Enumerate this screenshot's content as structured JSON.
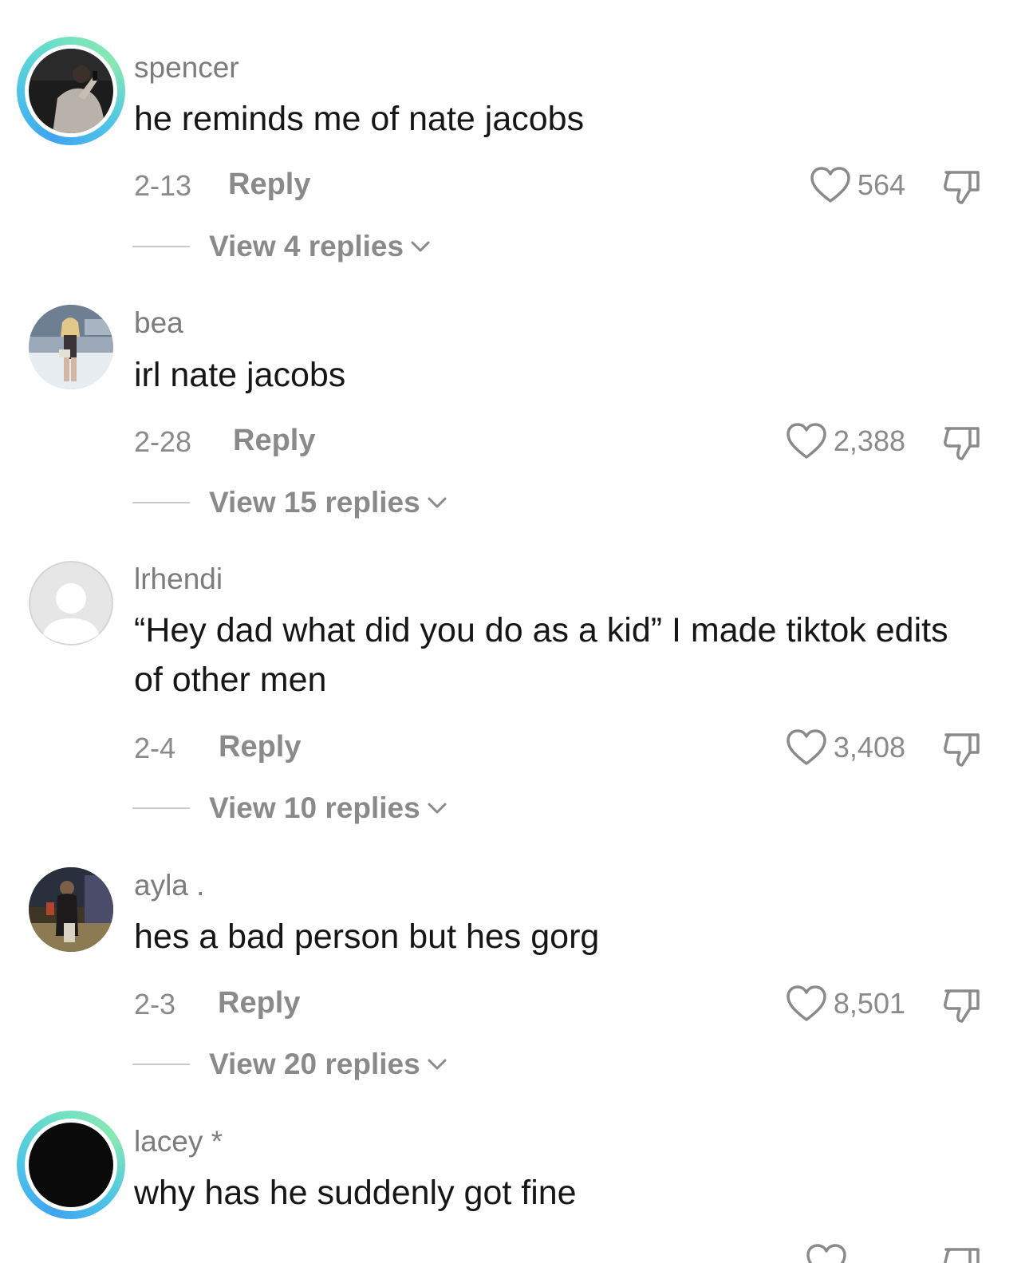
{
  "comments": [
    {
      "username": "spencer",
      "text": "he reminds me of nate jacobs",
      "date": "2-13",
      "reply_label": "Reply",
      "likes": "564",
      "view_replies": "View 4 replies",
      "avatar": "photo-man-phone",
      "story_ring": true
    },
    {
      "username": "bea",
      "text": "irl nate jacobs",
      "date": "2-28",
      "reply_label": "Reply",
      "likes": "2,388",
      "view_replies": "View 15 replies",
      "avatar": "photo-girl-snow",
      "story_ring": false
    },
    {
      "username": "lrhendi",
      "text": "“Hey dad what did you do as a kid” I made tiktok edits of other men",
      "date": "2-4",
      "reply_label": "Reply",
      "likes": "3,408",
      "view_replies": "View 10 replies",
      "avatar": "default-user-icon",
      "story_ring": false
    },
    {
      "username": "ayla .",
      "text": "hes a bad person but hes gorg",
      "date": "2-3",
      "reply_label": "Reply",
      "likes": "8,501",
      "view_replies": "View 20 replies",
      "avatar": "photo-night-street",
      "story_ring": false
    },
    {
      "username": "lacey *",
      "text": "why has he suddenly got fine",
      "avatar": "black-circle",
      "story_ring": true
    }
  ],
  "colors": {
    "text_primary": "#161616",
    "text_secondary": "#8a8a8a",
    "ring_start": "#3fa4f0",
    "ring_end": "#8ae8b0"
  }
}
